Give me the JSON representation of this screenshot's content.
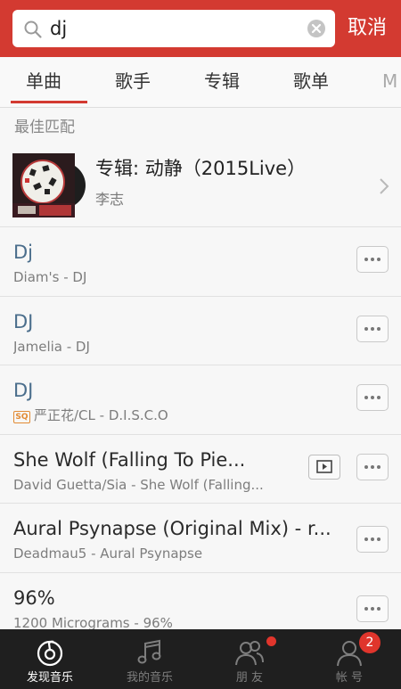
{
  "search": {
    "value": "dj",
    "cancel_label": "取消"
  },
  "tabs": [
    {
      "label": "单曲",
      "active": true
    },
    {
      "label": "歌手",
      "active": false
    },
    {
      "label": "专辑",
      "active": false
    },
    {
      "label": "歌单",
      "active": false
    },
    {
      "label": "M",
      "active": false
    }
  ],
  "best_match": {
    "section_label": "最佳匹配",
    "title": "专辑: 动静（2015Live）",
    "artist": "李志"
  },
  "songs": [
    {
      "title": "Dj",
      "subtitle": "Diam's - DJ",
      "title_color": "blue",
      "sq": false,
      "mv": false
    },
    {
      "title": "DJ",
      "subtitle": "Jamelia - DJ",
      "title_color": "blue",
      "sq": false,
      "mv": false
    },
    {
      "title": "DJ",
      "subtitle": "严正花/CL - D.I.S.C.O",
      "title_color": "blue",
      "sq": true,
      "sq_label": "SQ",
      "mv": false
    },
    {
      "title": "She Wolf (Falling To Pie...",
      "subtitle": "David Guetta/Sia - She Wolf (Falling...",
      "title_color": "dark",
      "sq": false,
      "mv": true
    },
    {
      "title": "Aural Psynapse (Original Mix) - r...",
      "subtitle": "Deadmau5 - Aural Psynapse",
      "title_color": "dark",
      "sq": false,
      "mv": false
    },
    {
      "title": "96%",
      "subtitle": "1200 Micrograms - 96%",
      "title_color": "dark",
      "sq": false,
      "mv": false
    }
  ],
  "bottom_nav": [
    {
      "label": "发现音乐",
      "icon": "netease-music-icon",
      "active": true
    },
    {
      "label": "我的音乐",
      "icon": "music-note-icon",
      "active": false
    },
    {
      "label": "朋 友",
      "icon": "friends-icon",
      "active": false,
      "dot": true
    },
    {
      "label": "帐 号",
      "icon": "account-icon",
      "active": false,
      "count": "2"
    }
  ],
  "colors": {
    "brand_red": "#d33a31",
    "link_blue": "#4b6e8c",
    "nav_bg": "#1f1f1f"
  }
}
